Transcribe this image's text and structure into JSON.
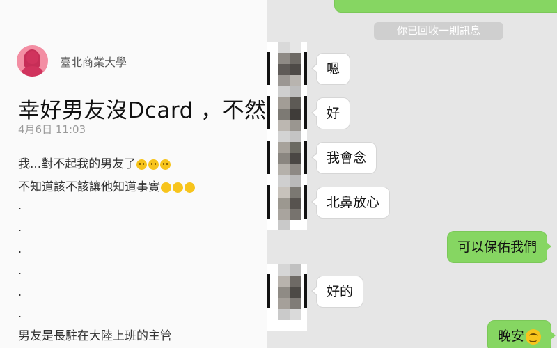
{
  "post": {
    "school": "臺北商業大學",
    "title": "幸好男友沒Dcard ，不然",
    "date": "4月6日 11:03",
    "lines": [
      "我...對不起我的男友了",
      "不知道該不該讓他知道事實",
      ".",
      ".",
      ".",
      ".",
      ".",
      ".",
      "男友是長駐在大陸上班的主管"
    ],
    "line1_emoji": [
      "neutral-face-icon",
      "neutral-face-icon",
      "neutral-face-icon"
    ],
    "line2_emoji": [
      "pensive-face-icon",
      "pensive-face-icon",
      "pensive-face-icon"
    ]
  },
  "chat": {
    "system_notice": "你已回收一則訊息",
    "messages": [
      {
        "side": "in",
        "text": "嗯"
      },
      {
        "side": "in",
        "text": "好"
      },
      {
        "side": "in",
        "text": "我會念"
      },
      {
        "side": "in",
        "text": "北鼻放心"
      },
      {
        "side": "out",
        "text": "可以保佑我們"
      },
      {
        "side": "in",
        "text": "好的"
      },
      {
        "side": "out",
        "text": "晚安",
        "emoji": "smiling-face-icon"
      }
    ],
    "colors": {
      "outgoing": "#86d662",
      "incoming": "#ffffff",
      "background": "#e6e6e6"
    }
  }
}
